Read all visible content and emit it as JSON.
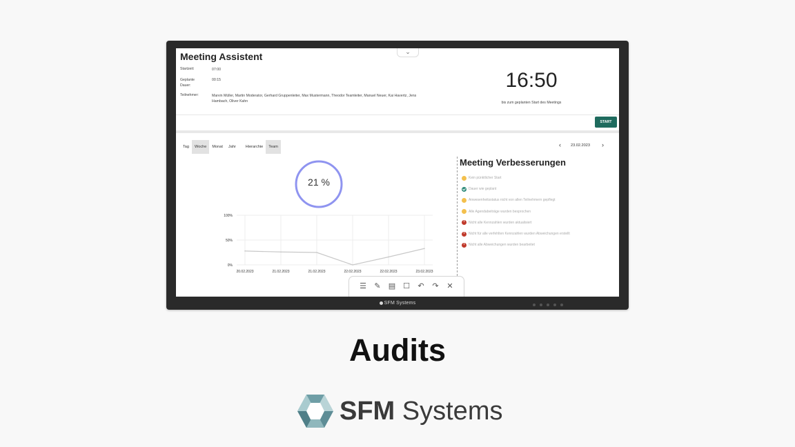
{
  "meeting": {
    "app_title": "Meeting Assistent",
    "collapse_chevron": "⌄",
    "fields": [
      {
        "label": "Startzeit:",
        "value": "07:00"
      },
      {
        "label": "Geplante Dauer:",
        "value": "00:15"
      },
      {
        "label": "Teilnehmer:",
        "value": "Marvin Müller, Martin Moderator, Gerhard Gruppenleiter, Max Mustermann, Theodor Teamleiter, Manuel Neuer, Kai Havertz, Jens Hambach, Oliver Kahn"
      }
    ],
    "countdown": "16:50",
    "countdown_caption": "bis zum geplanten Start des Meetings",
    "start_label": "START"
  },
  "tabs": [
    {
      "label": "Tag",
      "active": false
    },
    {
      "label": "Woche",
      "active": true
    },
    {
      "label": "Monat",
      "active": false
    },
    {
      "label": "Jahr",
      "active": false
    },
    {
      "label": "Hierarchie",
      "active": false
    },
    {
      "label": "Team",
      "active": true
    }
  ],
  "date_nav": {
    "prev": "‹",
    "date": "23.02.2023",
    "next": "›"
  },
  "score": {
    "label": "21 %",
    "value": 21,
    "ring_color": "#8f94f0"
  },
  "chart_data": {
    "type": "line",
    "x": [
      "20.02.2023",
      "21.02.2023",
      "21.02.2023",
      "22.02.2023",
      "22.02.2023",
      "23.02.2023"
    ],
    "series": [
      {
        "values": [
          28,
          26,
          25,
          0,
          16,
          33
        ]
      }
    ],
    "yticks": [
      "100%",
      "50%",
      "0%"
    ],
    "ylim": [
      0,
      100
    ],
    "grid": true,
    "line_color": "#c8c8c8"
  },
  "improvements": {
    "title": "Meeting Verbesserungen",
    "items": [
      {
        "icon": "warning-icon",
        "status": "warn",
        "label": "Kein pünktlicher Start"
      },
      {
        "icon": "check-icon",
        "status": "ok",
        "label": "Dauer wie geplant"
      },
      {
        "icon": "warning-icon",
        "status": "warn",
        "label": "Anwesenheitsstatus nicht von allen Teilnehmern gepflegt"
      },
      {
        "icon": "warning-icon",
        "status": "warn",
        "label": "Alle Agendabeiträge wurden besprochen"
      },
      {
        "icon": "error-icon",
        "status": "error",
        "label": "Nicht alle Kennzahlen wurden aktualisiert"
      },
      {
        "icon": "error-icon",
        "status": "error",
        "label": "Nicht für alle verfehlten Kennzahlen wurden Abweichungen erstellt"
      },
      {
        "icon": "error-icon",
        "status": "error",
        "label": "Nicht alle Abweichungen wurden bearbeitet"
      }
    ]
  },
  "toolbar": [
    {
      "name": "menu-icon",
      "glyph": "☰"
    },
    {
      "name": "note-icon",
      "glyph": "✎"
    },
    {
      "name": "clipboard-icon",
      "glyph": "▤"
    },
    {
      "name": "select-box-icon",
      "glyph": "☐"
    },
    {
      "name": "undo-icon",
      "glyph": "↶"
    },
    {
      "name": "redo-icon",
      "glyph": "↷"
    },
    {
      "name": "close-icon",
      "glyph": "✕"
    }
  ],
  "bezel_brand": "SFM Systems",
  "caption": "Audits",
  "logo": {
    "name_bold": "SFM",
    "name_regular": " Systems"
  }
}
